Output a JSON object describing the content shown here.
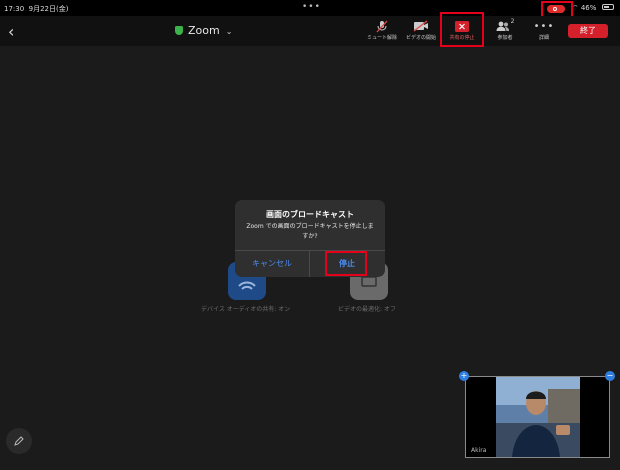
{
  "status_bar": {
    "time": "17:30",
    "date": "9月22日(金)",
    "battery": "46%",
    "more": "•••"
  },
  "header": {
    "back": "‹",
    "title": "Zoom",
    "chevron": "⌄"
  },
  "toolbar": {
    "mute": "ミュート解除",
    "video": "ビデオの開始",
    "stop_share": "共有の停止",
    "participants": "参加者",
    "participants_count": "2",
    "more": "詳細",
    "end": "終了"
  },
  "background": {
    "audio_share_label": "デバイス オーディオの共有: オン",
    "video_optimize_label": "ビデオの最適化: オフ"
  },
  "dialog": {
    "title": "画面のブロードキャスト",
    "message": "Zoom での画面のブロードキャストを停止しますか?",
    "cancel": "キャンセル",
    "stop": "停止"
  },
  "pip": {
    "name": "Akira"
  },
  "colors": {
    "accent_blue": "#4d8ef0",
    "end_red": "#d4202b",
    "highlight_red": "#e4001a",
    "secure_green": "#3bb34a"
  }
}
